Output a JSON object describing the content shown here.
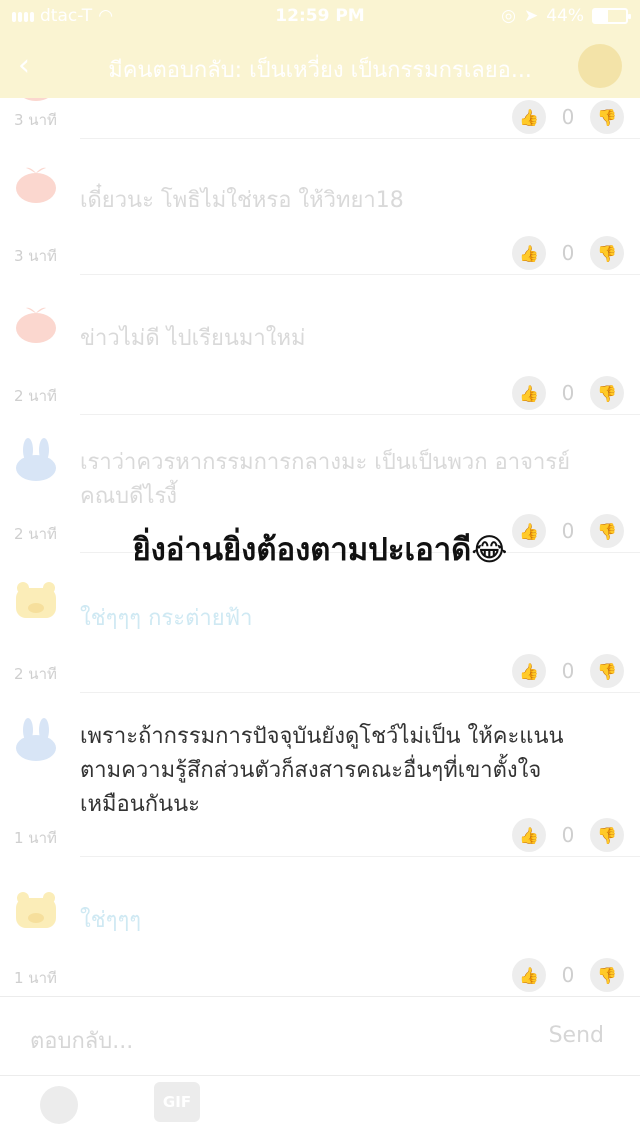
{
  "status_bar": {
    "carrier": "dtac-T",
    "time": "12:59 PM",
    "battery": "44%",
    "battery_level": 0.44
  },
  "header": {
    "title": "มีคนตอบกลับ: เป็นเหวี่ยง เป็นกรรมกรเลยอ...",
    "back_icon": "chevron-left-icon"
  },
  "comments": [
    {
      "avatar": "pear-avatar",
      "text": "",
      "ago": "3 นาที",
      "likes": "0"
    },
    {
      "avatar": "pear-avatar",
      "text": "เดี๋ยวนะ โพธิไม่ใช่หรอ ให้วิทยา18",
      "ago": "3 นาที",
      "likes": "0"
    },
    {
      "avatar": "pear-avatar",
      "text": "ข่าวไม่ดี ไปเรียนมาใหม่",
      "ago": "2 นาที",
      "likes": "0"
    },
    {
      "avatar": "rabbit-avatar",
      "text": "เราว่าควรหากรรมการกลางมะ เป็นเป็นพวก อาจารย์ คณบดีไรงี้",
      "ago": "2 นาที",
      "likes": "0"
    },
    {
      "avatar": "bear-avatar",
      "text": "ใช่ๆๆๆ กระต่ายฟ้า",
      "ago": "2 นาที",
      "likes": "0"
    },
    {
      "avatar": "rabbit-avatar",
      "text": "เพราะถ้ากรรมการปัจจุบันยังดูโชว์ไม่เป็น ให้คะแนนตามความรู้สึกส่วนตัวก็สงสารคณะอื่นๆที่เขาตั้งใจเหมือนกันนะ",
      "ago": "1 นาที",
      "likes": "0"
    },
    {
      "avatar": "bear-avatar",
      "text": "ใช่ๆๆๆ",
      "ago": "1 นาที",
      "likes": "0"
    }
  ],
  "overlay_caption": "ยิ่งอ่านยิ่งต้องตามปะเอาดี😂",
  "composer": {
    "placeholder": "ตอบกลับ...",
    "send_label": "Send",
    "gif_label": "GIF"
  }
}
